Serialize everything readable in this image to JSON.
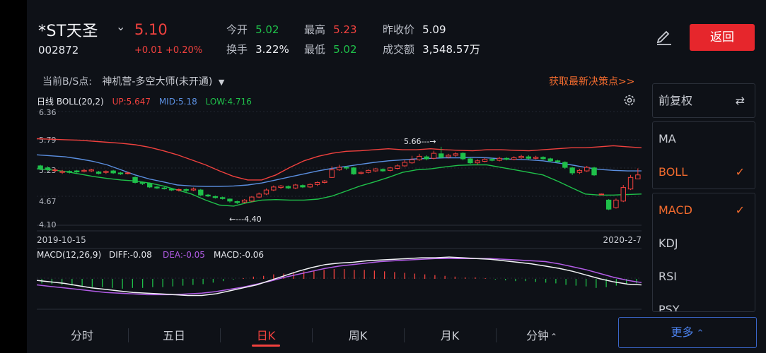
{
  "header": {
    "name": "*ST天圣",
    "code": "002872",
    "price": "5.10",
    "change": "+0.01",
    "change_pct": "+0.20%",
    "stats": [
      {
        "label": "今开",
        "value": "5.02",
        "color": "green"
      },
      {
        "label": "最高",
        "value": "5.23",
        "color": "red"
      },
      {
        "label": "昨收价",
        "value": "5.09",
        "color": "white"
      },
      {
        "label": "换手",
        "value": "3.22%",
        "color": "white"
      },
      {
        "label": "最低",
        "value": "5.02",
        "color": "green"
      },
      {
        "label": "成交额",
        "value": "3,548.57万",
        "color": "white"
      }
    ],
    "back_label": "返回"
  },
  "bs_row": {
    "label": "当前B/S点:",
    "strategy": "神机营-多空大师(未开通)",
    "link": "获取最新决策点>>"
  },
  "boll": {
    "name": "日线 BOLL(20,2)",
    "up": "UP:5.647",
    "mid": "MID:5.18",
    "low": "LOW:4.716"
  },
  "price_axis": [
    "6.36",
    "5.79",
    "5.23",
    "4.67",
    "4.10"
  ],
  "annotations": {
    "high": "5.66",
    "low": "4.40"
  },
  "dates": {
    "start": "2019-10-15",
    "end": "2020-2-7"
  },
  "macd": {
    "name": "MACD(12,26,9)",
    "diff": "DIFF:-0.08",
    "dea": "DEA:-0.05",
    "macd": "MACD:-0.06"
  },
  "side_menu": {
    "adjust": "前复权",
    "indicators_top": [
      {
        "label": "MA",
        "checked": false
      },
      {
        "label": "BOLL",
        "checked": true
      }
    ],
    "indicators_bottom": [
      {
        "label": "MACD",
        "checked": true
      },
      {
        "label": "KDJ",
        "checked": false
      },
      {
        "label": "RSI",
        "checked": false
      },
      {
        "label": "PSY",
        "checked": false
      }
    ]
  },
  "tabs": [
    "分时",
    "五日",
    "日K",
    "周K",
    "月K",
    "分钟"
  ],
  "active_tab": "日K",
  "more_label": "更多",
  "colors": {
    "up": "#f0413e",
    "down": "#1fc04a",
    "mid": "#5b8fe0",
    "dea": "#b25ce6",
    "accent": "#f26b2e"
  },
  "chart_data": {
    "type": "candlestick",
    "x_range": [
      "2019-10-15",
      "2020-2-7"
    ],
    "ylim": [
      4.1,
      6.36
    ],
    "y_ticks": [
      6.36,
      5.79,
      5.23,
      4.67,
      4.1
    ],
    "candles": [
      {
        "o": 5.28,
        "c": 5.22,
        "h": 5.3,
        "l": 5.2
      },
      {
        "o": 5.24,
        "c": 5.21,
        "h": 5.27,
        "l": 5.18
      },
      {
        "o": 5.19,
        "c": 5.2,
        "h": 5.23,
        "l": 5.16
      },
      {
        "o": 5.15,
        "c": 5.17,
        "h": 5.2,
        "l": 5.12
      },
      {
        "o": 5.17,
        "c": 5.15,
        "h": 5.19,
        "l": 5.13
      },
      {
        "o": 5.18,
        "c": 5.16,
        "h": 5.2,
        "l": 5.14
      },
      {
        "o": 5.17,
        "c": 5.19,
        "h": 5.22,
        "l": 5.15
      },
      {
        "o": 5.18,
        "c": 5.2,
        "h": 5.22,
        "l": 5.16
      },
      {
        "o": 5.16,
        "c": 5.13,
        "h": 5.18,
        "l": 5.11
      },
      {
        "o": 5.15,
        "c": 5.17,
        "h": 5.19,
        "l": 5.12
      },
      {
        "o": 5.18,
        "c": 5.14,
        "h": 5.2,
        "l": 5.12
      },
      {
        "o": 5.14,
        "c": 5.12,
        "h": 5.16,
        "l": 5.1
      },
      {
        "o": 5.13,
        "c": 5.14,
        "h": 5.16,
        "l": 5.11
      },
      {
        "o": 5.05,
        "c": 4.95,
        "h": 5.07,
        "l": 4.93
      },
      {
        "o": 4.95,
        "c": 4.93,
        "h": 4.97,
        "l": 4.9
      },
      {
        "o": 4.93,
        "c": 4.86,
        "h": 4.95,
        "l": 4.84
      },
      {
        "o": 4.86,
        "c": 4.84,
        "h": 4.88,
        "l": 4.82
      },
      {
        "o": 4.84,
        "c": 4.83,
        "h": 4.86,
        "l": 4.81
      },
      {
        "o": 4.82,
        "c": 4.8,
        "h": 4.84,
        "l": 4.78
      },
      {
        "o": 4.8,
        "c": 4.81,
        "h": 4.83,
        "l": 4.77
      },
      {
        "o": 4.81,
        "c": 4.79,
        "h": 4.83,
        "l": 4.76
      },
      {
        "o": 4.8,
        "c": 4.82,
        "h": 4.85,
        "l": 4.78
      },
      {
        "o": 4.8,
        "c": 4.7,
        "h": 4.82,
        "l": 4.68
      },
      {
        "o": 4.7,
        "c": 4.68,
        "h": 4.72,
        "l": 4.66
      },
      {
        "o": 4.67,
        "c": 4.65,
        "h": 4.69,
        "l": 4.63
      },
      {
        "o": 4.65,
        "c": 4.63,
        "h": 4.67,
        "l": 4.61
      },
      {
        "o": 4.62,
        "c": 4.58,
        "h": 4.63,
        "l": 4.55
      },
      {
        "o": 4.57,
        "c": 4.55,
        "h": 4.59,
        "l": 4.52
      },
      {
        "o": 4.56,
        "c": 4.6,
        "h": 4.62,
        "l": 4.54
      },
      {
        "o": 4.58,
        "c": 4.66,
        "h": 4.68,
        "l": 4.56
      },
      {
        "o": 4.66,
        "c": 4.72,
        "h": 4.75,
        "l": 4.64
      },
      {
        "o": 4.72,
        "c": 4.8,
        "h": 4.83,
        "l": 4.7
      },
      {
        "o": 4.8,
        "c": 4.86,
        "h": 4.89,
        "l": 4.78
      },
      {
        "o": 4.85,
        "c": 4.88,
        "h": 4.9,
        "l": 4.82
      },
      {
        "o": 4.87,
        "c": 4.84,
        "h": 4.89,
        "l": 4.82
      },
      {
        "o": 4.84,
        "c": 4.9,
        "h": 4.92,
        "l": 4.82
      },
      {
        "o": 4.89,
        "c": 4.86,
        "h": 4.91,
        "l": 4.84
      },
      {
        "o": 4.86,
        "c": 4.91,
        "h": 4.93,
        "l": 4.84
      },
      {
        "o": 4.91,
        "c": 4.95,
        "h": 4.97,
        "l": 4.88
      },
      {
        "o": 4.95,
        "c": 4.98,
        "h": 5.0,
        "l": 4.93
      },
      {
        "o": 5.05,
        "c": 5.2,
        "h": 5.27,
        "l": 5.04
      },
      {
        "o": 5.2,
        "c": 5.25,
        "h": 5.3,
        "l": 5.18
      },
      {
        "o": 5.25,
        "c": 5.24,
        "h": 5.27,
        "l": 5.2
      },
      {
        "o": 5.24,
        "c": 5.12,
        "h": 5.26,
        "l": 5.1
      },
      {
        "o": 5.13,
        "c": 5.15,
        "h": 5.17,
        "l": 5.11
      },
      {
        "o": 5.15,
        "c": 5.19,
        "h": 5.21,
        "l": 5.13
      },
      {
        "o": 5.18,
        "c": 5.22,
        "h": 5.24,
        "l": 5.16
      },
      {
        "o": 5.21,
        "c": 5.18,
        "h": 5.23,
        "l": 5.16
      },
      {
        "o": 5.19,
        "c": 5.24,
        "h": 5.26,
        "l": 5.17
      },
      {
        "o": 5.23,
        "c": 5.28,
        "h": 5.31,
        "l": 5.21
      },
      {
        "o": 5.28,
        "c": 5.35,
        "h": 5.4,
        "l": 5.26
      },
      {
        "o": 5.34,
        "c": 5.4,
        "h": 5.48,
        "l": 5.32
      },
      {
        "o": 5.4,
        "c": 5.47,
        "h": 5.52,
        "l": 5.38
      },
      {
        "o": 5.46,
        "c": 5.42,
        "h": 5.49,
        "l": 5.39
      },
      {
        "o": 5.43,
        "c": 5.53,
        "h": 5.58,
        "l": 5.41
      },
      {
        "o": 5.52,
        "c": 5.45,
        "h": 5.66,
        "l": 5.43
      },
      {
        "o": 5.46,
        "c": 5.49,
        "h": 5.52,
        "l": 5.43
      },
      {
        "o": 5.49,
        "c": 5.52,
        "h": 5.55,
        "l": 5.46
      },
      {
        "o": 5.53,
        "c": 5.42,
        "h": 5.55,
        "l": 5.39
      },
      {
        "o": 5.42,
        "c": 5.34,
        "h": 5.44,
        "l": 5.32
      },
      {
        "o": 5.34,
        "c": 5.38,
        "h": 5.41,
        "l": 5.31
      },
      {
        "o": 5.37,
        "c": 5.41,
        "h": 5.44,
        "l": 5.35
      },
      {
        "o": 5.41,
        "c": 5.39,
        "h": 5.44,
        "l": 5.37
      },
      {
        "o": 5.39,
        "c": 5.43,
        "h": 5.46,
        "l": 5.37
      },
      {
        "o": 5.43,
        "c": 5.41,
        "h": 5.45,
        "l": 5.39
      },
      {
        "o": 5.41,
        "c": 5.44,
        "h": 5.47,
        "l": 5.39
      },
      {
        "o": 5.44,
        "c": 5.47,
        "h": 5.5,
        "l": 5.42
      },
      {
        "o": 5.46,
        "c": 5.43,
        "h": 5.49,
        "l": 5.41
      },
      {
        "o": 5.43,
        "c": 5.45,
        "h": 5.48,
        "l": 5.41
      },
      {
        "o": 5.45,
        "c": 5.42,
        "h": 5.47,
        "l": 5.4
      },
      {
        "o": 5.42,
        "c": 5.38,
        "h": 5.44,
        "l": 5.36
      },
      {
        "o": 5.38,
        "c": 5.36,
        "h": 5.4,
        "l": 5.34
      },
      {
        "o": 5.35,
        "c": 5.25,
        "h": 5.37,
        "l": 5.22
      },
      {
        "o": 5.24,
        "c": 5.14,
        "h": 5.26,
        "l": 5.1
      },
      {
        "o": 5.15,
        "c": 5.19,
        "h": 5.22,
        "l": 5.12
      },
      {
        "o": 5.18,
        "c": 5.25,
        "h": 5.28,
        "l": 5.16
      },
      {
        "o": 5.24,
        "c": 5.1,
        "h": 5.26,
        "l": 5.08
      },
      {
        "o": 4.72,
        "c": 4.72,
        "h": 4.73,
        "l": 4.71
      },
      {
        "o": 4.6,
        "c": 4.42,
        "h": 4.62,
        "l": 4.4
      },
      {
        "o": 4.45,
        "c": 4.6,
        "h": 4.63,
        "l": 4.43
      },
      {
        "o": 4.58,
        "c": 4.85,
        "h": 4.9,
        "l": 4.56
      },
      {
        "o": 4.82,
        "c": 5.05,
        "h": 5.1,
        "l": 4.8
      },
      {
        "o": 5.02,
        "c": 5.1,
        "h": 5.23,
        "l": 5.02
      }
    ],
    "boll_up": [
      5.82,
      5.81,
      5.8,
      5.79,
      5.77,
      5.75,
      5.73,
      5.7,
      5.65,
      5.58,
      5.5,
      5.4,
      5.3,
      5.18,
      5.07,
      5.0,
      5.0,
      5.1,
      5.25,
      5.38,
      5.47,
      5.53,
      5.57,
      5.58,
      5.6,
      5.62,
      5.6,
      5.6,
      5.62,
      5.6,
      5.59,
      5.58,
      5.6,
      5.6,
      5.59,
      5.58,
      5.6,
      5.62,
      5.64,
      5.64,
      5.66,
      5.68,
      5.66,
      5.64
    ],
    "boll_mid": [
      5.5,
      5.48,
      5.46,
      5.42,
      5.37,
      5.3,
      5.2,
      5.1,
      5.02,
      4.96,
      4.9,
      4.88,
      4.87,
      4.87,
      4.88,
      4.9,
      4.94,
      5.0,
      5.06,
      5.12,
      5.18,
      5.23,
      5.27,
      5.31,
      5.35,
      5.38,
      5.4,
      5.42,
      5.43,
      5.44,
      5.44,
      5.45,
      5.44,
      5.42,
      5.41,
      5.4,
      5.38,
      5.34,
      5.3,
      5.25,
      5.21,
      5.19,
      5.18,
      5.18
    ],
    "boll_low": [
      5.22,
      5.2,
      5.17,
      5.12,
      5.07,
      5.03,
      5.0,
      4.98,
      4.94,
      4.88,
      4.8,
      4.72,
      4.6,
      4.5,
      4.48,
      4.55,
      4.6,
      4.61,
      4.6,
      4.6,
      4.62,
      4.68,
      4.78,
      4.88,
      4.96,
      5.05,
      5.15,
      5.2,
      5.22,
      5.26,
      5.29,
      5.3,
      5.3,
      5.25,
      5.2,
      5.15,
      5.1,
      4.98,
      4.85,
      4.72,
      4.7,
      4.7,
      4.71,
      4.72
    ],
    "macd_hist": [
      -0.06,
      -0.07,
      -0.08,
      -0.09,
      -0.1,
      -0.11,
      -0.11,
      -0.12,
      -0.13,
      -0.12,
      -0.12,
      -0.11,
      -0.11,
      -0.1,
      -0.09,
      -0.08,
      -0.07,
      -0.05,
      -0.03,
      -0.01,
      0.01,
      0.03,
      0.04,
      0.06,
      0.07,
      0.09,
      0.1,
      0.11,
      0.12,
      0.13,
      0.13,
      0.12,
      0.12,
      0.11,
      0.1,
      0.09,
      0.08,
      0.07,
      0.06,
      0.05,
      0.04,
      0.03,
      0.02,
      0.02,
      0.01,
      -0.01,
      -0.02,
      -0.03,
      -0.03,
      -0.04,
      -0.05,
      -0.06,
      -0.08,
      -0.09,
      -0.1,
      -0.12,
      -0.11,
      -0.09,
      -0.07,
      -0.06
    ],
    "macd_diff": [
      -0.02,
      -0.04,
      -0.06,
      -0.09,
      -0.12,
      -0.14,
      -0.16,
      -0.18,
      -0.19,
      -0.2,
      -0.21,
      -0.22,
      -0.22,
      -0.2,
      -0.16,
      -0.12,
      -0.08,
      -0.02,
      0.04,
      0.1,
      0.15,
      0.19,
      0.21,
      0.22,
      0.24,
      0.25,
      0.26,
      0.27,
      0.28,
      0.28,
      0.29,
      0.28,
      0.27,
      0.26,
      0.24,
      0.22,
      0.2,
      0.17,
      0.14,
      0.1,
      0.05,
      0.0,
      -0.04,
      -0.07,
      -0.08
    ],
    "macd_dea": [
      -0.08,
      -0.1,
      -0.12,
      -0.14,
      -0.16,
      -0.18,
      -0.19,
      -0.2,
      -0.21,
      -0.21,
      -0.21,
      -0.2,
      -0.19,
      -0.17,
      -0.14,
      -0.11,
      -0.07,
      -0.03,
      0.02,
      0.06,
      0.1,
      0.14,
      0.17,
      0.19,
      0.21,
      0.23,
      0.24,
      0.25,
      0.26,
      0.27,
      0.27,
      0.27,
      0.27,
      0.27,
      0.26,
      0.25,
      0.24,
      0.23,
      0.2,
      0.16,
      0.12,
      0.07,
      0.02,
      -0.02,
      -0.05
    ]
  }
}
